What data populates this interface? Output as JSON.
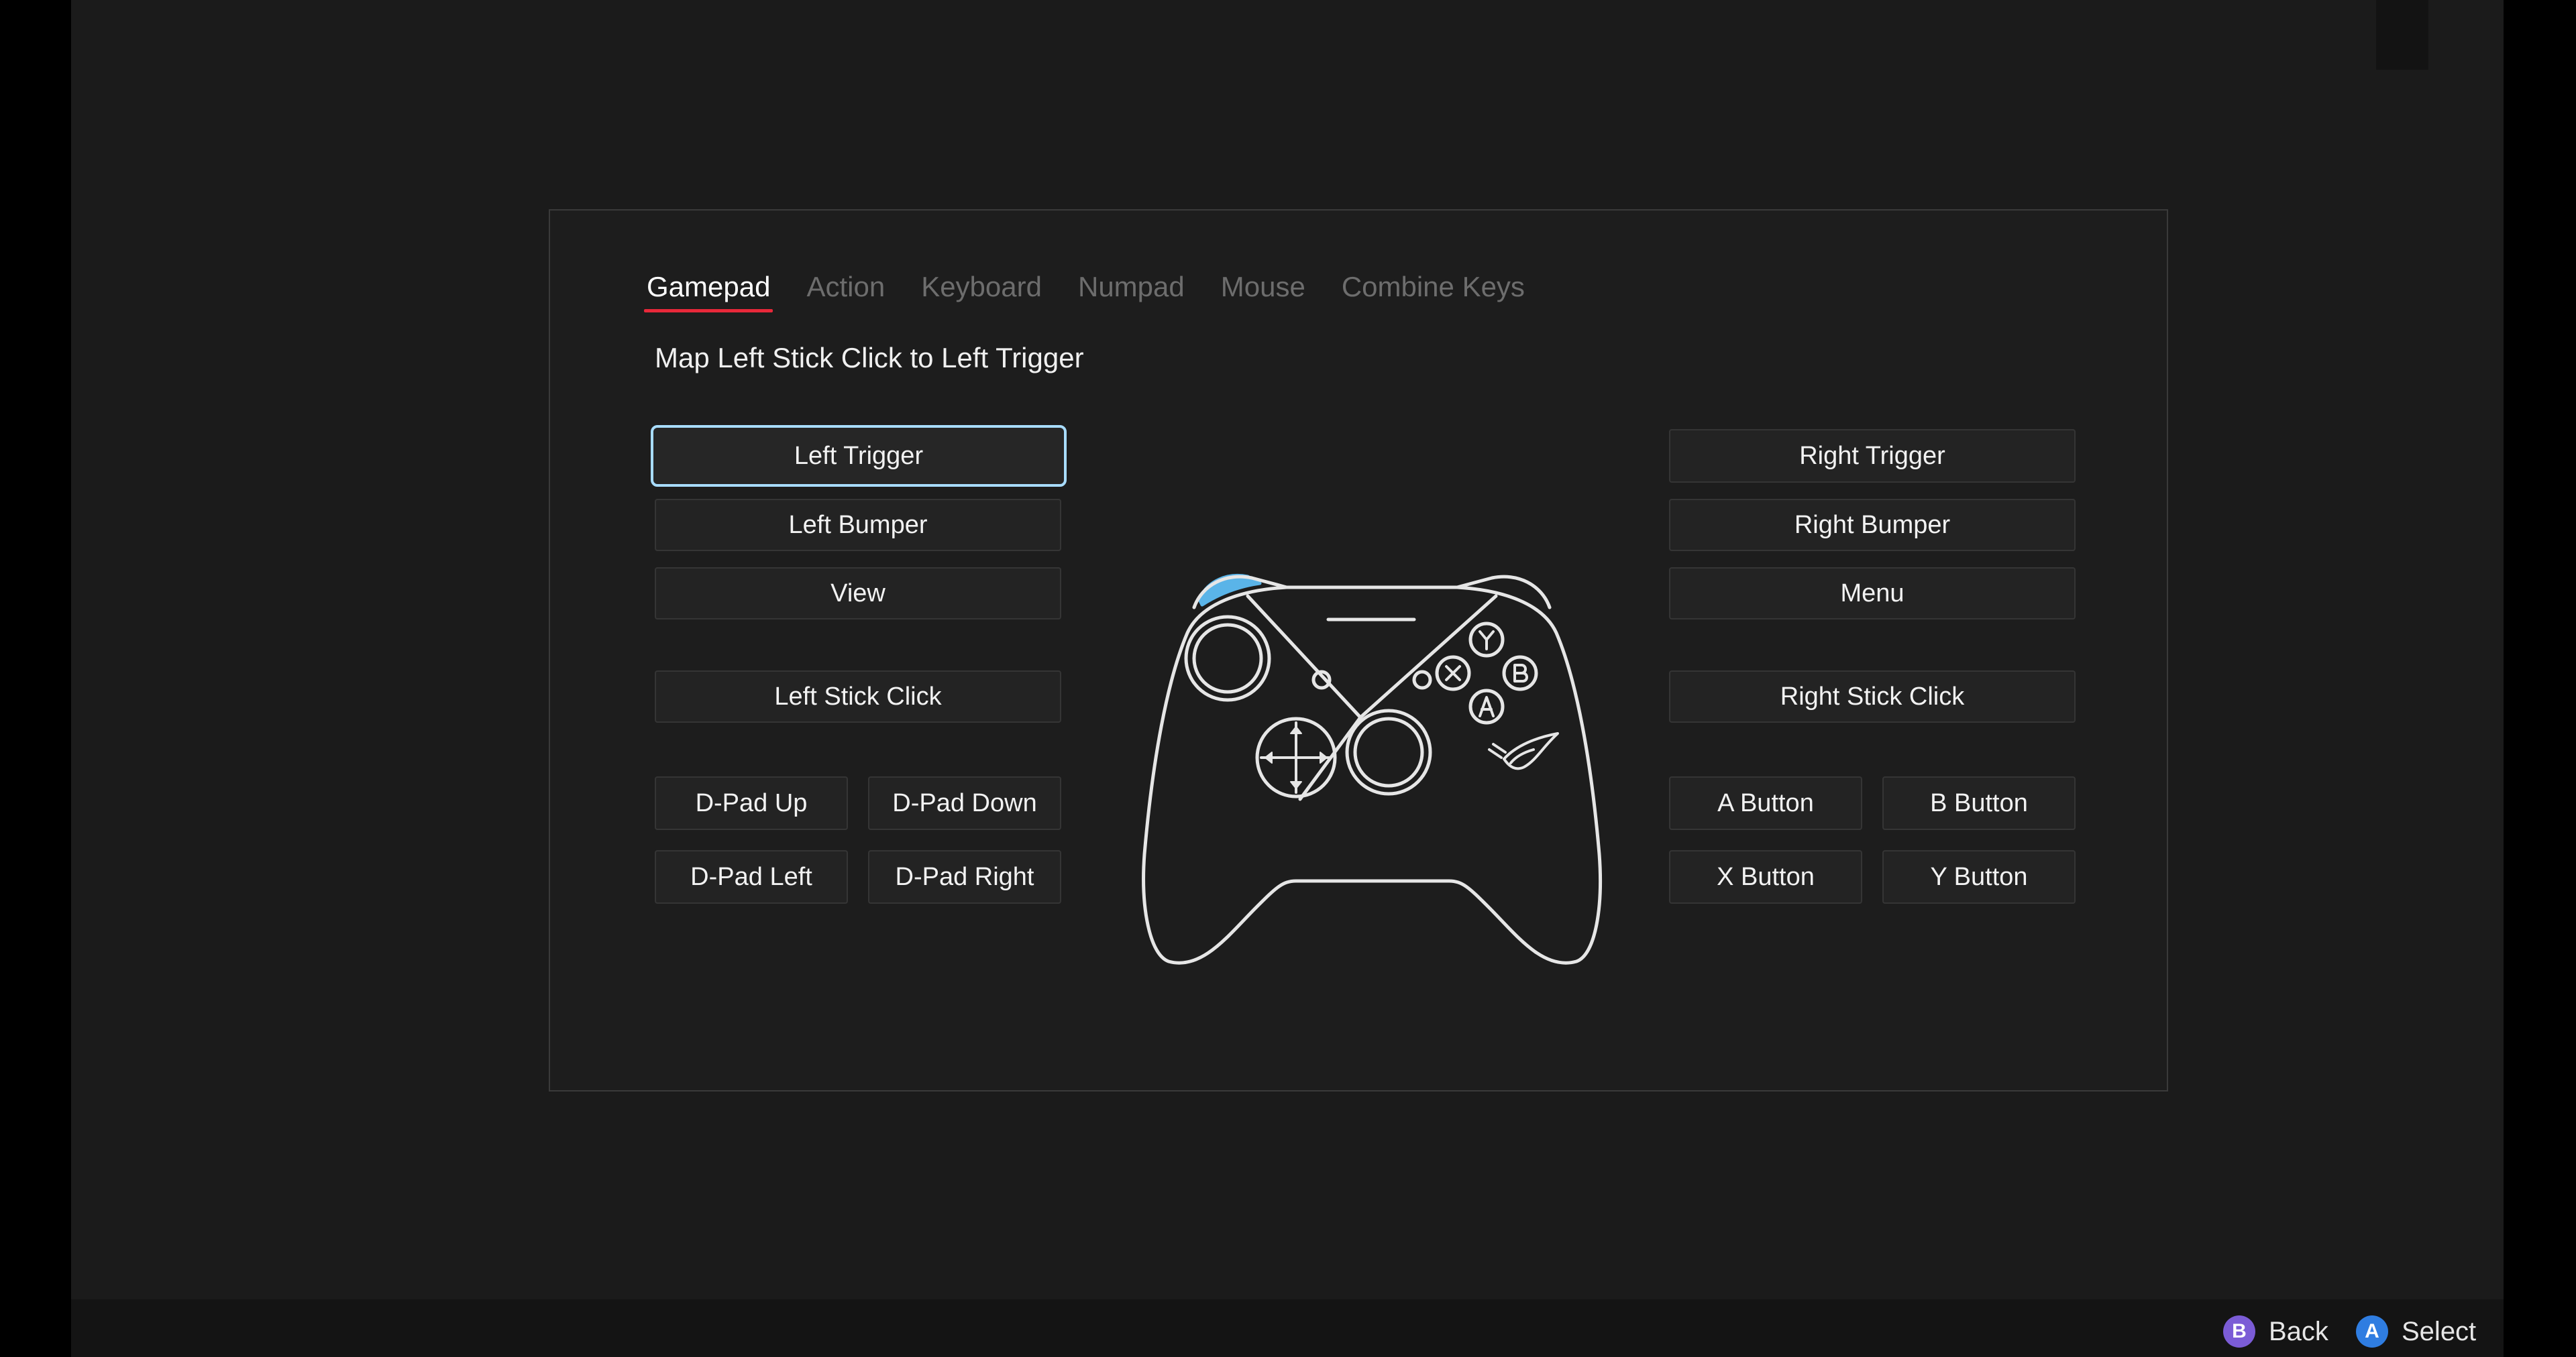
{
  "tabs": [
    {
      "label": "Gamepad"
    },
    {
      "label": "Action"
    },
    {
      "label": "Keyboard"
    },
    {
      "label": "Numpad"
    },
    {
      "label": "Mouse"
    },
    {
      "label": "Combine Keys"
    }
  ],
  "subtitle": "Map Left Stick Click to Left Trigger",
  "left_buttons": {
    "left_trigger": "Left Trigger",
    "left_bumper": "Left Bumper",
    "view": "View",
    "left_stick_click": "Left Stick Click",
    "dpad_up": "D-Pad Up",
    "dpad_down": "D-Pad Down",
    "dpad_left": "D-Pad Left",
    "dpad_right": "D-Pad Right"
  },
  "right_buttons": {
    "right_trigger": "Right Trigger",
    "right_bumper": "Right Bumper",
    "menu": "Menu",
    "right_stick_click": "Right Stick Click",
    "a_button": "A Button",
    "b_button": "B Button",
    "x_button": "X Button",
    "y_button": "Y Button"
  },
  "footer": {
    "back": {
      "glyph": "B",
      "label": "Back",
      "color": "#7b5cd6"
    },
    "select": {
      "glyph": "A",
      "label": "Select",
      "color": "#2f7de1"
    }
  },
  "colors": {
    "accent_tab": "#e8283a",
    "selection_border": "#a8dcff",
    "trigger_highlight": "#5ab4e8"
  }
}
